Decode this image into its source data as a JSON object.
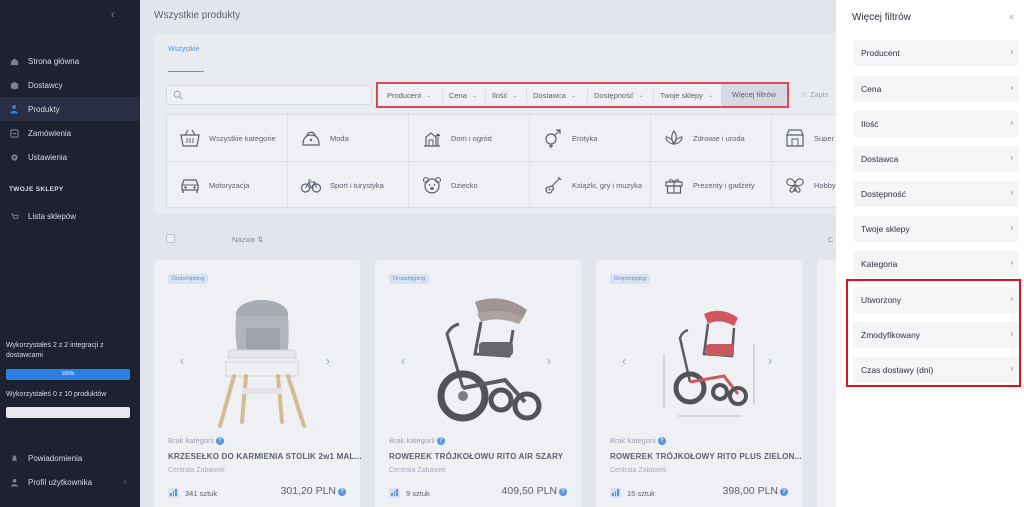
{
  "sidebar": {
    "nav": [
      {
        "label": "Strona główna",
        "icon": "home-icon"
      },
      {
        "label": "Dostawcy",
        "icon": "box-icon"
      },
      {
        "label": "Produkty",
        "icon": "person-icon",
        "active": true
      },
      {
        "label": "Zamówienia",
        "icon": "orders-icon"
      },
      {
        "label": "Ustawienia",
        "icon": "gear-icon"
      }
    ],
    "section_title": "TWOJE SKLEPY",
    "shops_label": "Lista sklepów",
    "integration_usage": "Wykorzystałeś 2 z 2 integracji z dostawcami",
    "integration_percent": "100%",
    "integration_fraction": 1.0,
    "product_usage": "Wykorzystałeś 0 z 10 produktów",
    "product_fraction": 0.0,
    "notifications_label": "Powiadomienia",
    "profile_label": "Profil użytkownika"
  },
  "main": {
    "title": "Wszystkie produkty",
    "tab_all": "Wszystkie",
    "filters": [
      "Producent",
      "Cena",
      "Ilość",
      "Dostawca",
      "Dostępność",
      "Twoje sklepy"
    ],
    "more_filters": "Więcej filtrów",
    "save_label": "Zapis",
    "categories": [
      {
        "label": "Wszystkie kategorie",
        "icon": "basket-icon"
      },
      {
        "label": "Moda",
        "icon": "bag-icon"
      },
      {
        "label": "Dom i ogród",
        "icon": "home-garden-icon"
      },
      {
        "label": "Erotyka",
        "icon": "gender-icon"
      },
      {
        "label": "Zdrowie i uroda",
        "icon": "lotus-icon"
      },
      {
        "label": "Super",
        "icon": "market-icon"
      },
      {
        "label": "Motoryzacja",
        "icon": "car-icon"
      },
      {
        "label": "Sport i turystyka",
        "icon": "bicycle-icon"
      },
      {
        "label": "Dziecko",
        "icon": "bear-icon"
      },
      {
        "label": "Książki, gry i muzyka",
        "icon": "guitar-icon"
      },
      {
        "label": "Prezenty i gadżety",
        "icon": "gift-icon"
      },
      {
        "label": "Hobby",
        "icon": "butterfly-icon"
      }
    ],
    "column_name": "Nazwa",
    "column_c": "C",
    "sort_glyph": "⇅"
  },
  "products": [
    {
      "badge": "Dropshipping",
      "category": "Brak kategorii",
      "title": "KRZESEŁKO DO KARMIENIA STOLIK 2w1 MAL...",
      "supplier": "Centrala Zabawek",
      "stock": "341 sztuk",
      "price": "301,20 PLN"
    },
    {
      "badge": "Dropshipping",
      "category": "Brak kategorii",
      "title": "ROWEREK TRÓJKOŁOWU RITO AIR SZARY",
      "supplier": "Centrala Zabawek",
      "stock": "9 sztuk",
      "price": "409,50 PLN"
    },
    {
      "badge": "Dropshipping",
      "category": "Brak kategorii",
      "title": "ROWEREK TRÓJKOŁOWY RITO PLUS ZIELON...",
      "supplier": "Centrala Zabawek",
      "stock": "15 sztuk",
      "price": "398,00 PLN"
    }
  ],
  "drawer": {
    "title": "Więcej filtrów",
    "close_glyph": "×",
    "items": [
      "Producent",
      "Cena",
      "Ilość",
      "Dostawca",
      "Dostępność",
      "Twoje sklepy",
      "Kategoria",
      "Utworzony",
      "Zmodyfikowany",
      "Czas dostawy (dni)"
    ]
  },
  "colors": {
    "accent": "#2b7fe0",
    "sidebar_bg": "#1e2130",
    "highlight": "#e1121f"
  }
}
